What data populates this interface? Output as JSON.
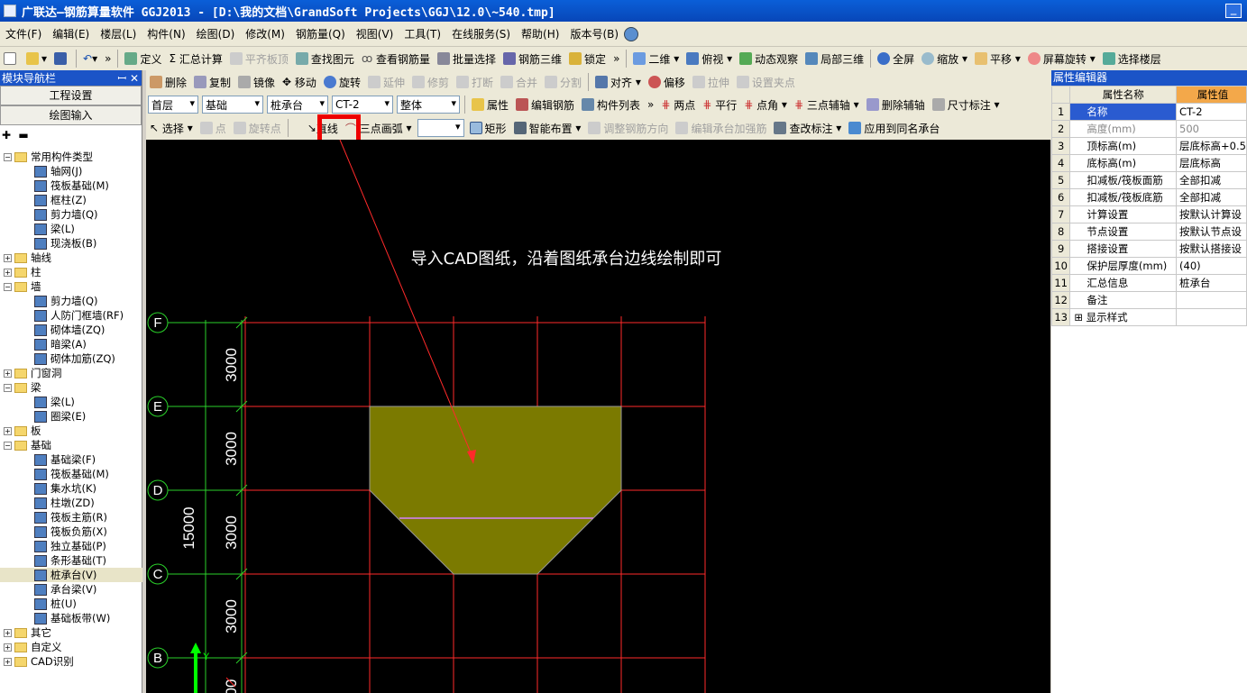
{
  "window": {
    "title": "广联达—钢筋算量软件 GGJ2013 - [D:\\我的文档\\GrandSoft Projects\\GGJ\\12.0\\~540.tmp]"
  },
  "menu": [
    "文件(F)",
    "编辑(E)",
    "楼层(L)",
    "构件(N)",
    "绘图(D)",
    "修改(M)",
    "钢筋量(Q)",
    "视图(V)",
    "工具(T)",
    "在线服务(S)",
    "帮助(H)",
    "版本号(B)"
  ],
  "toolbar1": {
    "items": [
      "定义",
      "汇总计算",
      "平齐板顶",
      "查找图元",
      "查看钢筋量",
      "批量选择",
      "钢筋三维",
      "锁定"
    ],
    "view_mode": "二维",
    "view_items": [
      "俯视",
      "动态观察",
      "局部三维"
    ],
    "right_items": [
      "全屏",
      "缩放",
      "平移",
      "屏幕旋转",
      "选择楼层"
    ]
  },
  "toolbar2": {
    "items": [
      "删除",
      "复制",
      "镜像",
      "移动",
      "旋转",
      "延伸",
      "修剪",
      "打断",
      "合并",
      "分割",
      "对齐",
      "偏移",
      "拉伸",
      "设置夹点"
    ]
  },
  "toolbar3": {
    "floor": "首层",
    "category": "基础",
    "type": "桩承台",
    "component": "CT-2",
    "mode": "整体",
    "items": [
      "属性",
      "编辑钢筋",
      "构件列表",
      "两点",
      "平行",
      "点角",
      "三点辅轴",
      "删除辅轴",
      "尺寸标注"
    ]
  },
  "toolbar4": {
    "items": [
      "选择",
      "点",
      "旋转点",
      "直线",
      "三点画弧",
      "矩形",
      "智能布置",
      "调整钢筋方向",
      "编辑承台加强筋",
      "查改标注",
      "应用到同名承台"
    ]
  },
  "nav": {
    "title": "模块导航栏",
    "pin": "ꟷ ✕",
    "btn_project": "工程设置",
    "btn_draw": "绘图输入"
  },
  "tree": [
    {
      "t": "f",
      "label": "常用构件类型",
      "open": true
    },
    {
      "t": "l",
      "label": "轴网(J)"
    },
    {
      "t": "l",
      "label": "筏板基础(M)"
    },
    {
      "t": "l",
      "label": "框柱(Z)"
    },
    {
      "t": "l",
      "label": "剪力墙(Q)"
    },
    {
      "t": "l",
      "label": "梁(L)"
    },
    {
      "t": "l",
      "label": "现浇板(B)"
    },
    {
      "t": "f",
      "label": "轴线",
      "open": false
    },
    {
      "t": "f",
      "label": "柱",
      "open": false
    },
    {
      "t": "f",
      "label": "墙",
      "open": true
    },
    {
      "t": "l",
      "label": "剪力墙(Q)"
    },
    {
      "t": "l",
      "label": "人防门框墙(RF)"
    },
    {
      "t": "l",
      "label": "砌体墙(ZQ)"
    },
    {
      "t": "l",
      "label": "暗梁(A)"
    },
    {
      "t": "l",
      "label": "砌体加筋(ZQ)"
    },
    {
      "t": "f",
      "label": "门窗洞",
      "open": false
    },
    {
      "t": "f",
      "label": "梁",
      "open": true
    },
    {
      "t": "l",
      "label": "梁(L)"
    },
    {
      "t": "l",
      "label": "圈梁(E)"
    },
    {
      "t": "f",
      "label": "板",
      "open": false
    },
    {
      "t": "f",
      "label": "基础",
      "open": true
    },
    {
      "t": "l",
      "label": "基础梁(F)"
    },
    {
      "t": "l",
      "label": "筏板基础(M)"
    },
    {
      "t": "l",
      "label": "集水坑(K)"
    },
    {
      "t": "l",
      "label": "柱墩(ZD)"
    },
    {
      "t": "l",
      "label": "筏板主筋(R)"
    },
    {
      "t": "l",
      "label": "筏板负筋(X)"
    },
    {
      "t": "l",
      "label": "独立基础(P)"
    },
    {
      "t": "l",
      "label": "条形基础(T)"
    },
    {
      "t": "l",
      "label": "桩承台(V)",
      "sel": true
    },
    {
      "t": "l",
      "label": "承台梁(V)"
    },
    {
      "t": "l",
      "label": "桩(U)"
    },
    {
      "t": "l",
      "label": "基础板带(W)"
    },
    {
      "t": "f",
      "label": "其它",
      "open": false
    },
    {
      "t": "f",
      "label": "自定义",
      "open": false
    },
    {
      "t": "f",
      "label": "CAD识别",
      "open": false
    }
  ],
  "canvas": {
    "annotation": "导入CAD图纸，沿着图纸承台边线绘制即可",
    "axes": [
      "F",
      "E",
      "D",
      "C",
      "B"
    ],
    "dims": [
      "3000",
      "3000",
      "3000",
      "3000"
    ],
    "total": "15000",
    "partial_dim": "00",
    "coord_y": "Y",
    "colors": {
      "grid": "#ff2a2a",
      "dim": "#2ad12a",
      "shape": "#7b7a00"
    }
  },
  "props": {
    "title": "属性编辑器",
    "col_name": "属性名称",
    "col_value": "属性值",
    "rows": [
      {
        "n": "1",
        "k": "名称",
        "v": "CT-2",
        "hl": true
      },
      {
        "n": "2",
        "k": "高度(mm)",
        "v": "500",
        "gray": true
      },
      {
        "n": "3",
        "k": "顶标高(m)",
        "v": "层底标高+0.5"
      },
      {
        "n": "4",
        "k": "底标高(m)",
        "v": "层底标高"
      },
      {
        "n": "5",
        "k": "扣减板/筏板面筋",
        "v": "全部扣减"
      },
      {
        "n": "6",
        "k": "扣减板/筏板底筋",
        "v": "全部扣减"
      },
      {
        "n": "7",
        "k": "计算设置",
        "v": "按默认计算设"
      },
      {
        "n": "8",
        "k": "节点设置",
        "v": "按默认节点设"
      },
      {
        "n": "9",
        "k": "搭接设置",
        "v": "按默认搭接设"
      },
      {
        "n": "10",
        "k": "保护层厚度(mm)",
        "v": "(40)"
      },
      {
        "n": "11",
        "k": "汇总信息",
        "v": "桩承台"
      },
      {
        "n": "12",
        "k": "备注",
        "v": ""
      },
      {
        "n": "13",
        "k": "显示样式",
        "v": "",
        "exp": true
      }
    ]
  }
}
